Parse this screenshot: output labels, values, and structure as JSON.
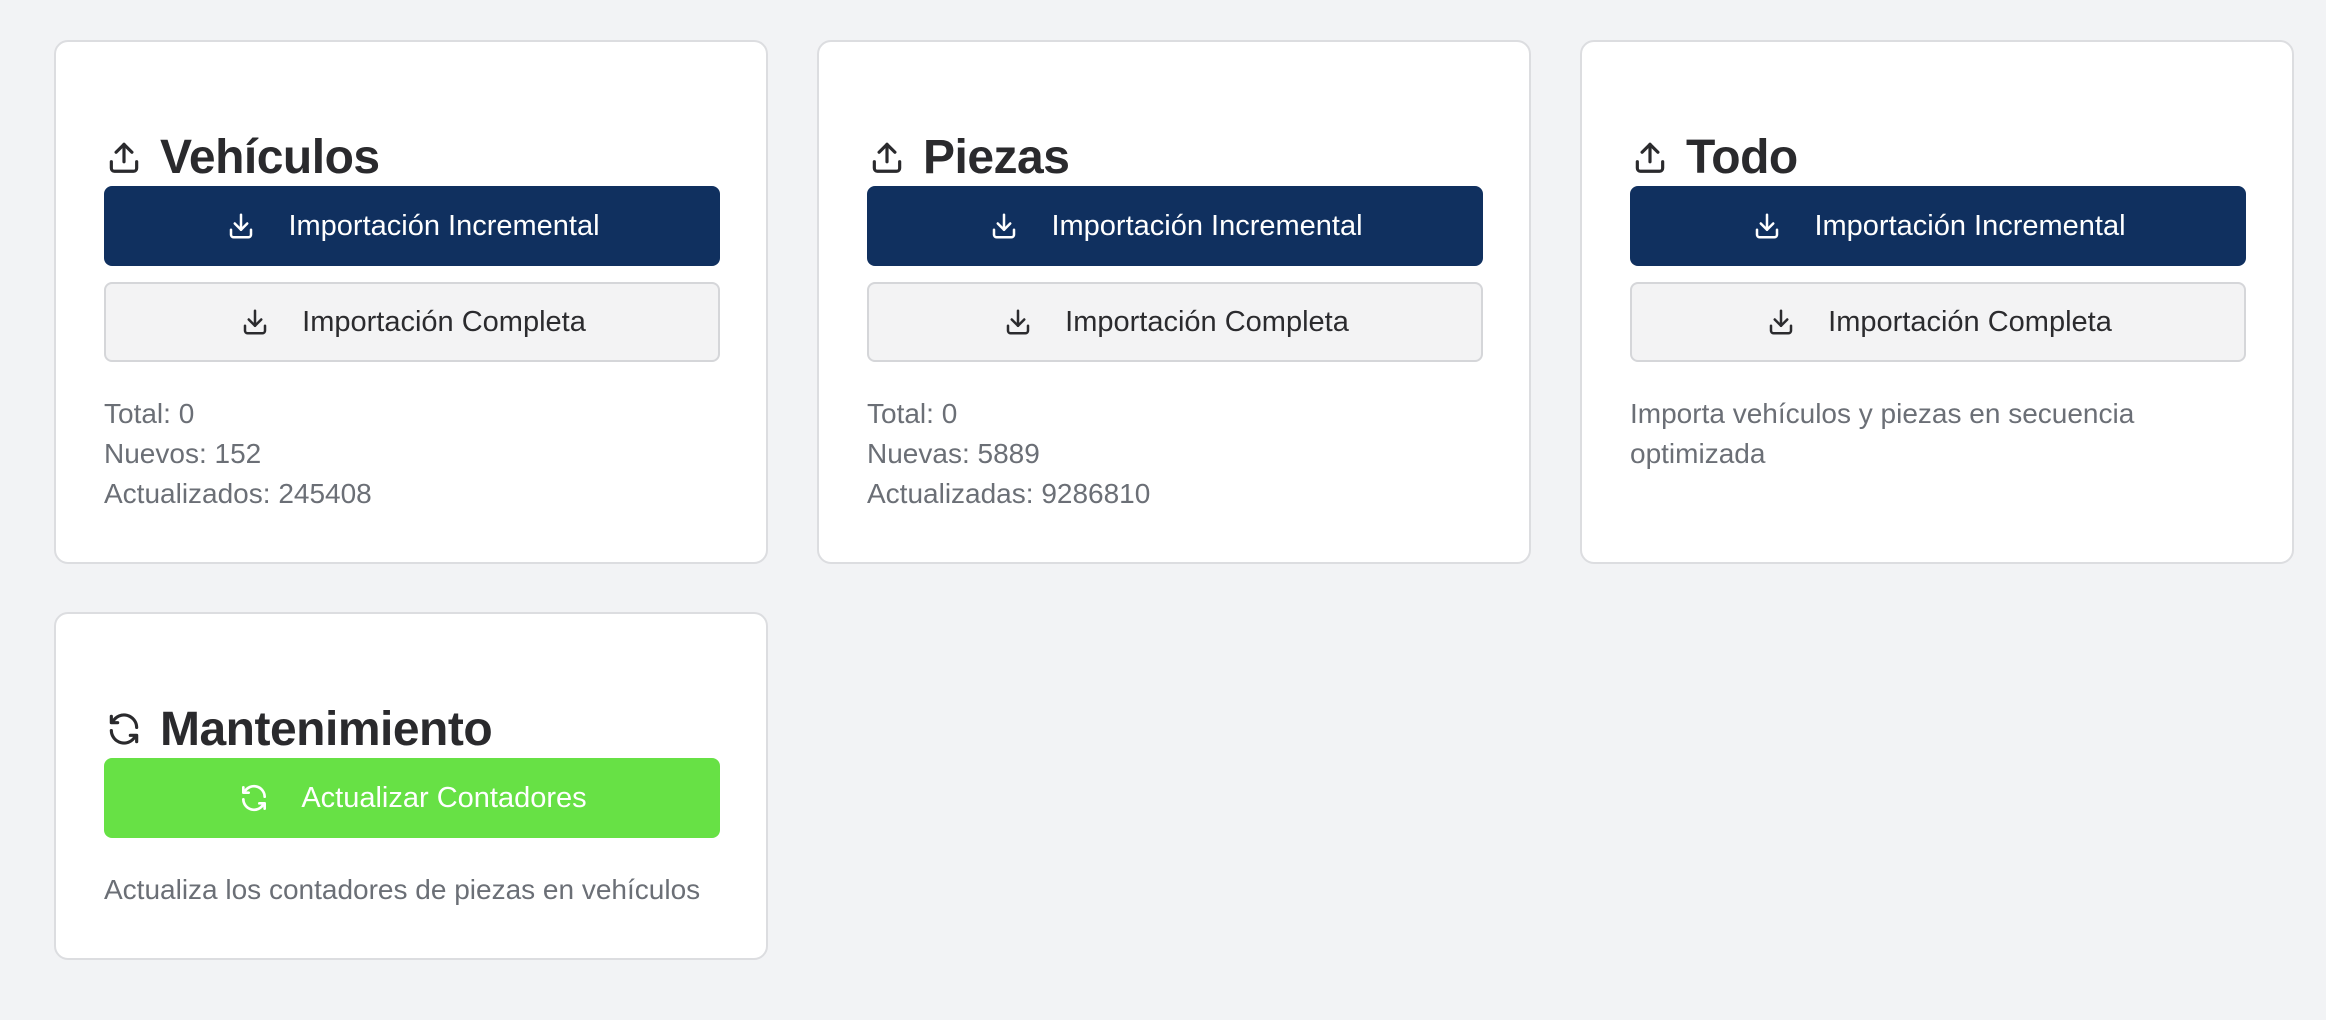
{
  "cards": {
    "vehiculos": {
      "title": "Vehículos",
      "incremental_label": "Importación Incremental",
      "complete_label": "Importación Completa",
      "stats": {
        "total": "Total: 0",
        "nuevos": "Nuevos: 152",
        "actualizados": "Actualizados: 245408"
      }
    },
    "piezas": {
      "title": "Piezas",
      "incremental_label": "Importación Incremental",
      "complete_label": "Importación Completa",
      "stats": {
        "total": "Total: 0",
        "nuevas": "Nuevas: 5889",
        "actualizadas": "Actualizadas: 9286810"
      }
    },
    "todo": {
      "title": "Todo",
      "incremental_label": "Importación Incremental",
      "complete_label": "Importación Completa",
      "description": "Importa vehículos y piezas en secuencia optimizada"
    },
    "mantenimiento": {
      "title": "Mantenimiento",
      "button_label": "Actualizar Contadores",
      "description": "Actualiza los contadores de piezas en vehículos"
    }
  },
  "icons": {
    "card_header": "upload-icon",
    "buttons": "download-icon",
    "maintenance": "refresh-icon"
  },
  "colors": {
    "background": "#f2f3f5",
    "primary_button": "#10305f",
    "secondary_button": "#f3f3f4",
    "green_button": "#67e145",
    "muted_text": "#6b6f76",
    "title_text": "#2a2a2d"
  }
}
